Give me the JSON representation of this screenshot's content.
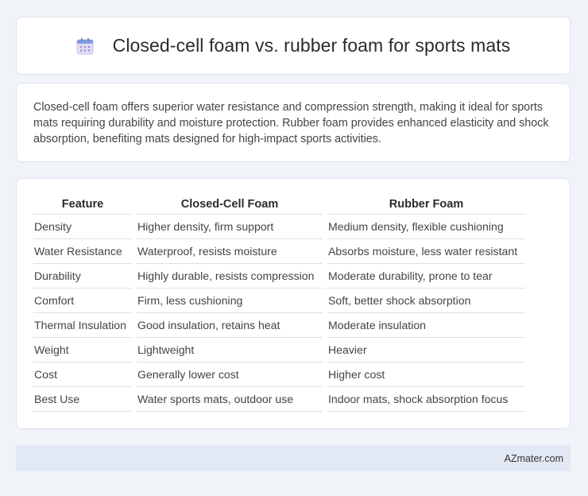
{
  "header": {
    "title": "Closed-cell foam vs. rubber foam for sports mats",
    "icon": "calendar-icon"
  },
  "description": "Closed-cell foam offers superior water resistance and compression strength, making it ideal for sports mats requiring durability and moisture protection. Rubber foam provides enhanced elasticity and shock absorption, benefiting mats designed for high-impact sports activities.",
  "table": {
    "headers": [
      "Feature",
      "Closed-Cell Foam",
      "Rubber Foam"
    ],
    "rows": [
      [
        "Density",
        "Higher density, firm support",
        "Medium density, flexible cushioning"
      ],
      [
        "Water Resistance",
        "Waterproof, resists moisture",
        "Absorbs moisture, less water resistant"
      ],
      [
        "Durability",
        "Highly durable, resists compression",
        "Moderate durability, prone to tear"
      ],
      [
        "Comfort",
        "Firm, less cushioning",
        "Soft, better shock absorption"
      ],
      [
        "Thermal Insulation",
        "Good insulation, retains heat",
        "Moderate insulation"
      ],
      [
        "Weight",
        "Lightweight",
        "Heavier"
      ],
      [
        "Cost",
        "Generally lower cost",
        "Higher cost"
      ],
      [
        "Best Use",
        "Water sports mats, outdoor use",
        "Indoor mats, shock absorption focus"
      ]
    ]
  },
  "footer": {
    "text": "AZmater.com"
  },
  "colors": {
    "background": "#f0f3f8",
    "card": "#ffffff",
    "footer_bg": "#e3e9f4"
  }
}
